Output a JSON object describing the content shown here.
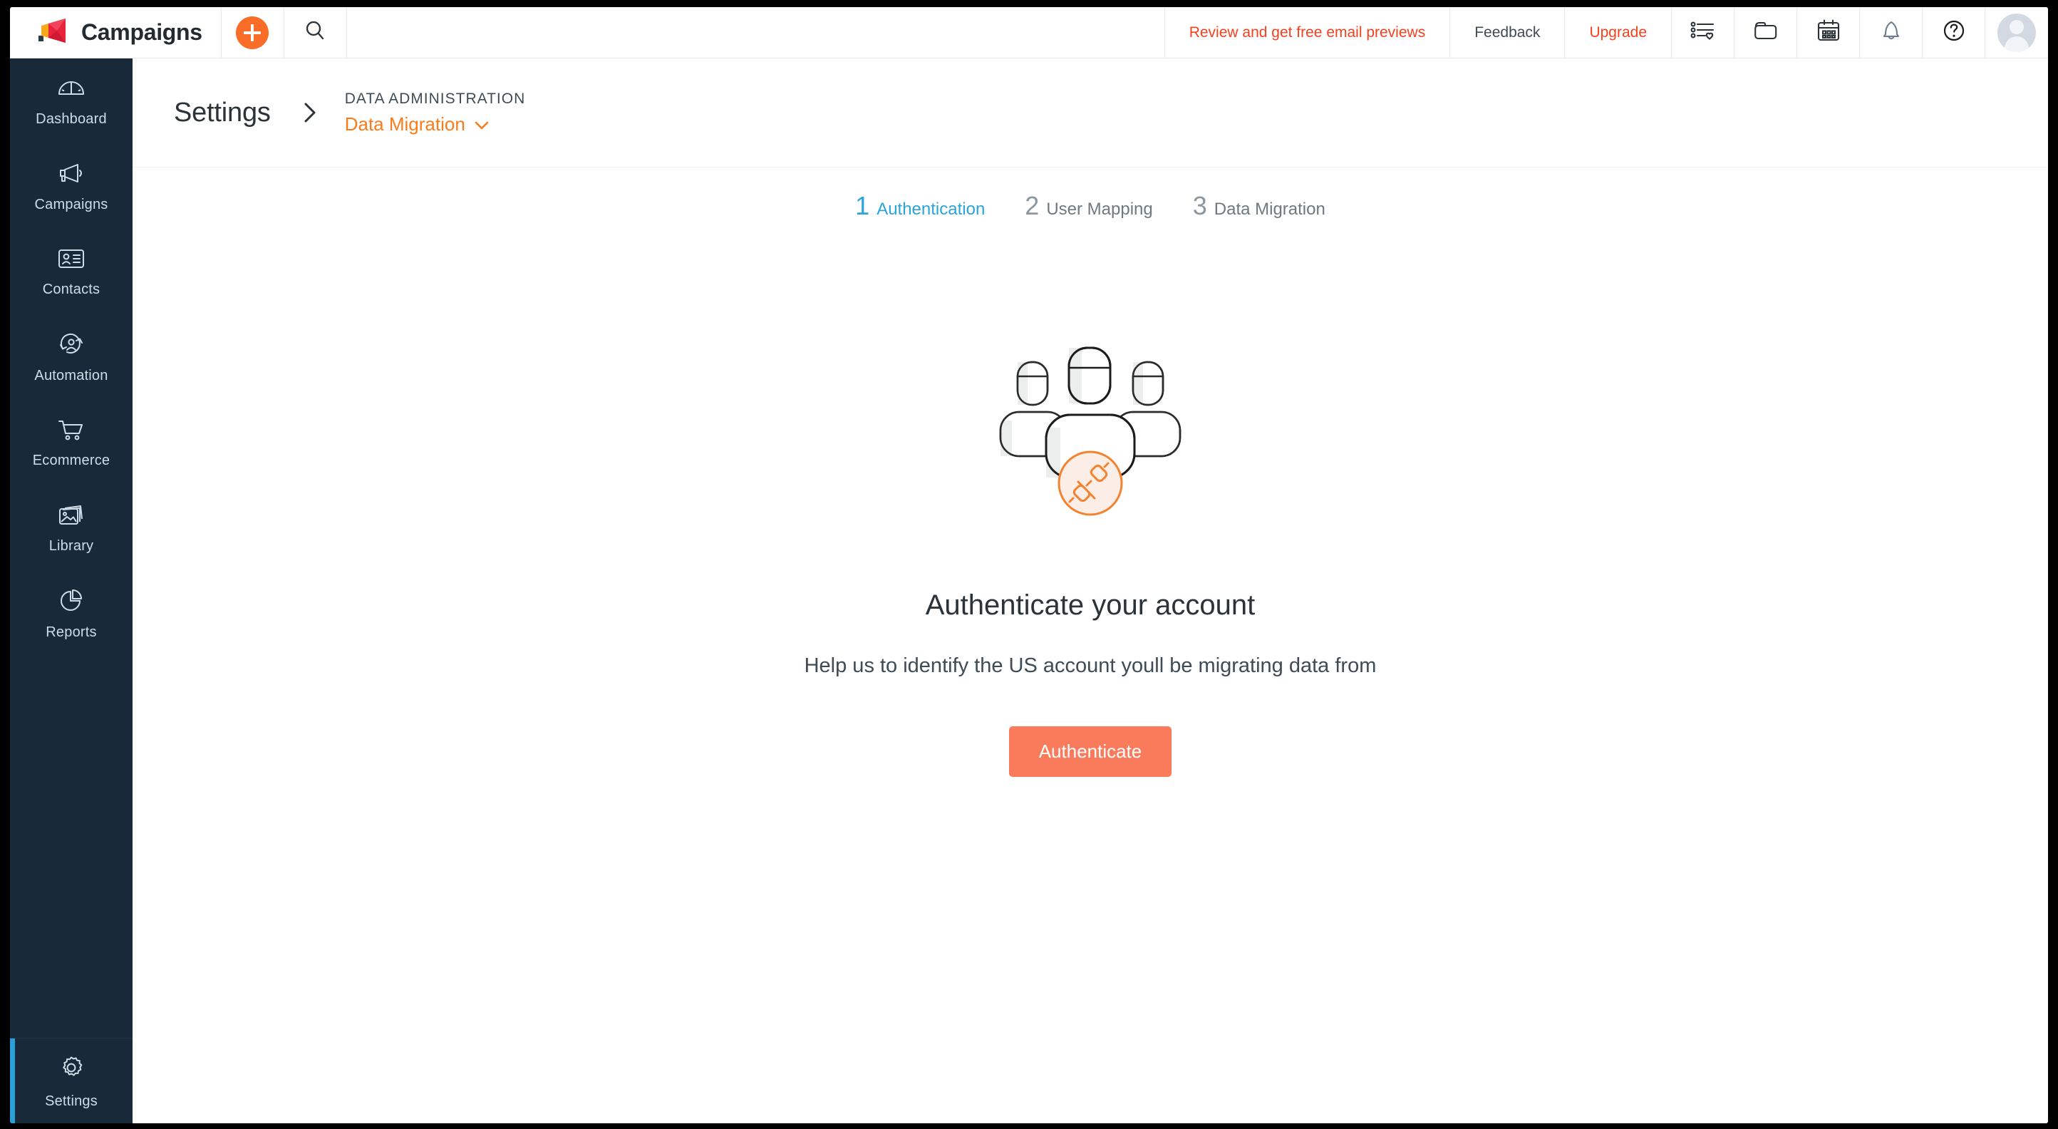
{
  "topbar": {
    "brand": "Campaigns",
    "brand_logo_icon": "megaphone-logo-icon",
    "create_icon": "plus-icon",
    "search_icon": "search-icon",
    "promo_link": "Review and get free email previews",
    "feedback_link": "Feedback",
    "upgrade_link": "Upgrade",
    "icons": [
      {
        "name": "list-heart-icon"
      },
      {
        "name": "folder-icon"
      },
      {
        "name": "calendar-icon"
      },
      {
        "name": "bell-icon"
      },
      {
        "name": "help-icon"
      }
    ],
    "avatar_icon": "user-avatar",
    "promo_color": "#f6401e",
    "upgrade_color": "#f6401e",
    "feedback_color": "#3f4b55",
    "plus_color": "#f96d28"
  },
  "sidebar": {
    "background": "#18293a",
    "active_indicator_color": "#2a9fd8",
    "items": [
      {
        "label": "Dashboard",
        "icon": "gauge-icon"
      },
      {
        "label": "Campaigns",
        "icon": "megaphone-icon"
      },
      {
        "label": "Contacts",
        "icon": "contact-card-icon"
      },
      {
        "label": "Automation",
        "icon": "automation-icon"
      },
      {
        "label": "Ecommerce",
        "icon": "shopping-cart-icon"
      },
      {
        "label": "Library",
        "icon": "images-icon"
      },
      {
        "label": "Reports",
        "icon": "pie-chart-icon"
      }
    ],
    "footer": {
      "label": "Settings",
      "icon": "gear-icon",
      "active": true
    }
  },
  "header": {
    "title": "Settings",
    "separator_icon": "chevron-right-icon",
    "kicker": "DATA ADMINISTRATION",
    "current": "Data Migration",
    "current_color": "#f97c1c",
    "dropdown_icon": "chevron-down-icon"
  },
  "main": {
    "steps": [
      {
        "num": "1",
        "label": "Authentication",
        "active": true
      },
      {
        "num": "2",
        "label": "User Mapping",
        "active": false
      },
      {
        "num": "3",
        "label": "Data Migration",
        "active": false
      }
    ],
    "active_step_color": "#29a4dc",
    "illustration_icon": "people-connect-illustration",
    "title": "Authenticate your account",
    "subtitle": "Help us to identify the US account youll be migrating data from",
    "cta_label": "Authenticate",
    "cta_color": "#fa7b5b"
  }
}
